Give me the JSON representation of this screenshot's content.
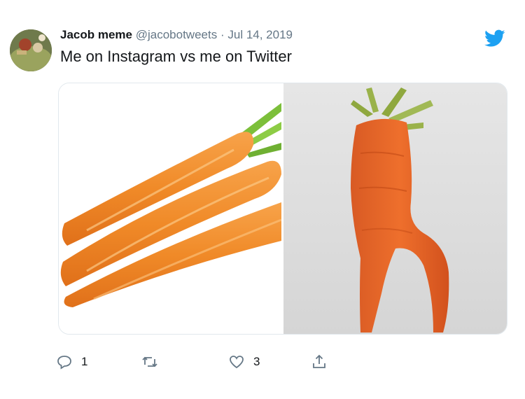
{
  "tweet": {
    "author_name": "Jacob meme",
    "handle": "@jacobotweets",
    "separator": "·",
    "date": "Jul 14, 2019",
    "text": "Me on Instagram vs me on Twitter"
  },
  "actions": {
    "reply_count": "1",
    "retweet_count": "",
    "like_count": "3"
  },
  "icons": {
    "brand": "twitter-bird-icon",
    "reply": "reply-icon",
    "retweet": "retweet-icon",
    "like": "heart-icon",
    "share": "share-icon"
  },
  "colors": {
    "brand_blue": "#1da1f2",
    "text_primary": "#14171a",
    "text_secondary": "#657786",
    "carrot_orange": "#f28a2e"
  }
}
